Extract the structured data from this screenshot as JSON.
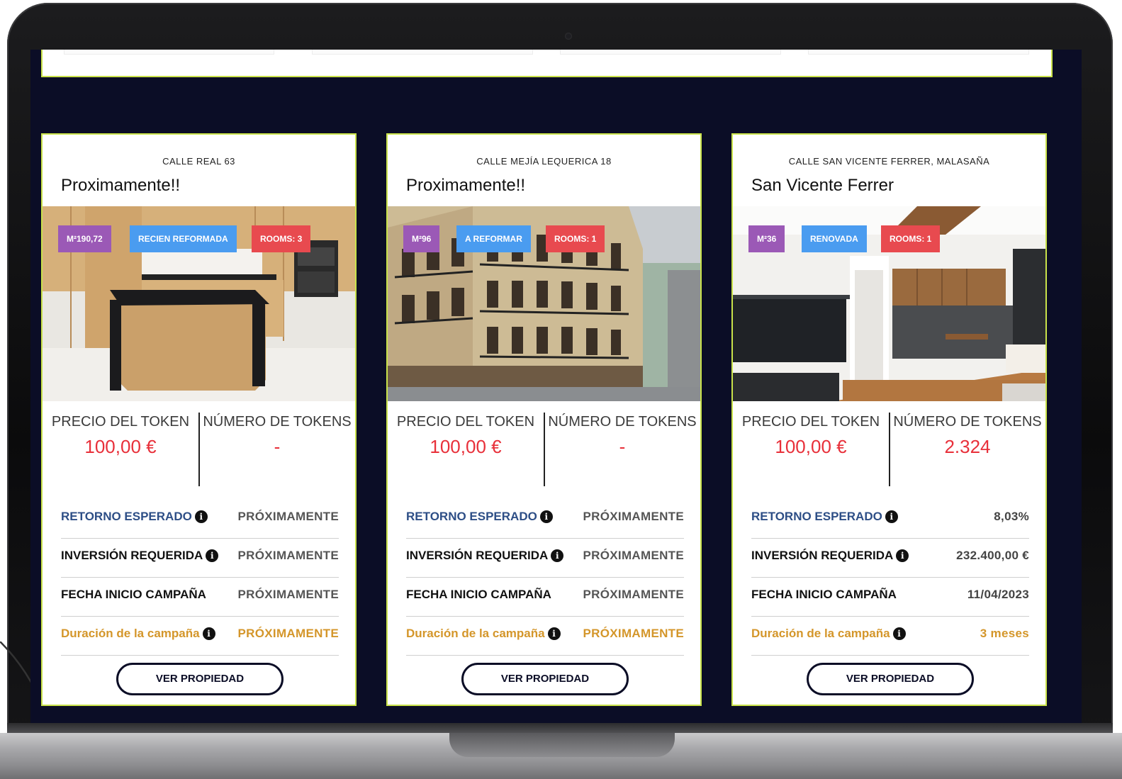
{
  "cards": [
    {
      "address": "CALLE REAL 63",
      "title": "Proximamente!!",
      "badges": {
        "m2": "M²190,72",
        "state": "RECIEN REFORMADA",
        "rooms": "ROOMS: 3"
      },
      "token_price_label": "PRECIO DEL TOKEN",
      "token_price": "100,00 €",
      "token_count_label": "NÚMERO DE TOKENS",
      "token_count": "-",
      "rows": {
        "retorno_label": "RETORNO ESPERADO",
        "retorno_value": "PRÓXIMAMENTE",
        "inversion_label": "INVERSIÓN REQUERIDA",
        "inversion_value": "PRÓXIMAMENTE",
        "fecha_label": "FECHA INICIO CAMPAÑA",
        "fecha_value": "PRÓXIMAMENTE",
        "duracion_label": "Duración de la campaña",
        "duracion_value": "PRÓXIMAMENTE"
      },
      "button": "VER PROPIEDAD",
      "photo": "kitchen-wood-island"
    },
    {
      "address": "CALLE MEJÍA LEQUERICA 18",
      "title": "Proximamente!!",
      "badges": {
        "m2": "M²96",
        "state": "A REFORMAR",
        "rooms": "ROOMS: 1"
      },
      "token_price_label": "PRECIO DEL TOKEN",
      "token_price": "100,00 €",
      "token_count_label": "NÚMERO DE TOKENS",
      "token_count": "-",
      "rows": {
        "retorno_label": "RETORNO ESPERADO",
        "retorno_value": "PRÓXIMAMENTE",
        "inversion_label": "INVERSIÓN REQUERIDA",
        "inversion_value": "PRÓXIMAMENTE",
        "fecha_label": "FECHA INICIO CAMPAÑA",
        "fecha_value": "PRÓXIMAMENTE",
        "duracion_label": "Duración de la campaña",
        "duracion_value": "PRÓXIMAMENTE"
      },
      "button": "VER PROPIEDAD",
      "photo": "classic-building-facade"
    },
    {
      "address": "CALLE SAN VICENTE FERRER, MALASAÑA",
      "title": "San Vicente Ferrer",
      "badges": {
        "m2": "M²36",
        "state": "RENOVADA",
        "rooms": "ROOMS: 1"
      },
      "token_price_label": "PRECIO DEL TOKEN",
      "token_price": "100,00 €",
      "token_count_label": "NÚMERO DE TOKENS",
      "token_count": "2.324",
      "rows": {
        "retorno_label": "RETORNO ESPERADO",
        "retorno_value": "8,03%",
        "inversion_label": "INVERSIÓN REQUERIDA",
        "inversion_value": "232.400,00 €",
        "fecha_label": "FECHA INICIO CAMPAÑA",
        "fecha_value": "11/04/2023",
        "duracion_label": "Duración de la campaña",
        "duracion_value": "3 meses"
      },
      "button": "VER PROPIEDAD",
      "photo": "renovated-living-kitchen"
    }
  ],
  "icons": {
    "info": "info-icon",
    "camera": "camera-icon"
  },
  "colors": {
    "screen_bg": "#0b0d26",
    "card_border": "#c9e24a",
    "price_red": "#e8303a",
    "retorno_blue": "#2d4e86",
    "duracion_orange": "#d4962a",
    "badge_purple": "#9b59b6",
    "badge_blue": "#4a9cf0",
    "badge_red": "#e84a4f"
  }
}
